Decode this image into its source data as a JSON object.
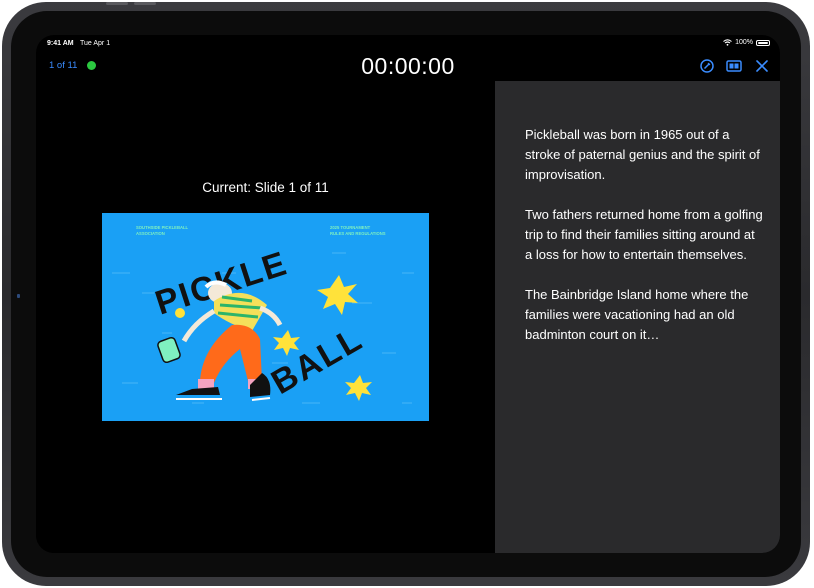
{
  "status_bar": {
    "time": "9:41 AM",
    "date": "Tue Apr 1",
    "battery": "100%"
  },
  "toolbar": {
    "slide_count": "1 of 11",
    "timer": "00:00:00",
    "icons": [
      "edit-notes-icon",
      "layout-icon",
      "close-icon"
    ],
    "accent_color": "#3a8cff",
    "live_indicator_color": "#2bc840"
  },
  "presenter": {
    "current_label": "Current: Slide 1 of 11",
    "slide": {
      "header_left": [
        "SOUTHSIDE PICKLEBALL",
        "ASSOCIATION"
      ],
      "header_right": [
        "2025 TOURNAMENT",
        "RULES AND REGULATIONS"
      ],
      "title_top": "PICKLE",
      "title_bottom": "BALL",
      "background_color": "#1aa0f5"
    }
  },
  "notes": {
    "paragraphs": [
      "Pickleball was born in 1965 out of a stroke of paternal genius and the spirit of improvisation.",
      "Two fathers returned home from a golfing trip to find their families sitting around at a loss for how to entertain themselves.",
      "The Bainbridge Island home where the families were vacationing had an old badminton court on it…"
    ]
  }
}
